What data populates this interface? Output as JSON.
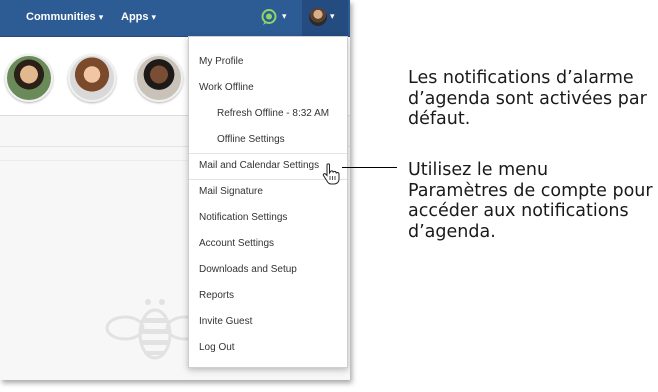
{
  "topbar": {
    "communities_label": "Communities",
    "apps_label": "Apps",
    "chevron": "⌄",
    "status_icon": "chat-status-icon",
    "avatar_icon": "user-avatar-icon"
  },
  "menu": {
    "items": [
      "My Profile",
      "Work Offline",
      "Refresh Offline - 8:32 AM",
      "Offline Settings",
      "Mail and Calendar Settings",
      "Mail Signature",
      "Notification Settings",
      "Account Settings",
      "Downloads and Setup",
      "Reports",
      "Invite Guest",
      "Log Out"
    ]
  },
  "callouts": {
    "top": "Les notifications d’alarme d’agenda sont activées par défaut.",
    "bottom": "Utilisez le menu Paramètres de compte pour accéder aux notifications d’agenda."
  },
  "colors": {
    "topbar": "#2d5b94",
    "menu_text": "#333333"
  }
}
